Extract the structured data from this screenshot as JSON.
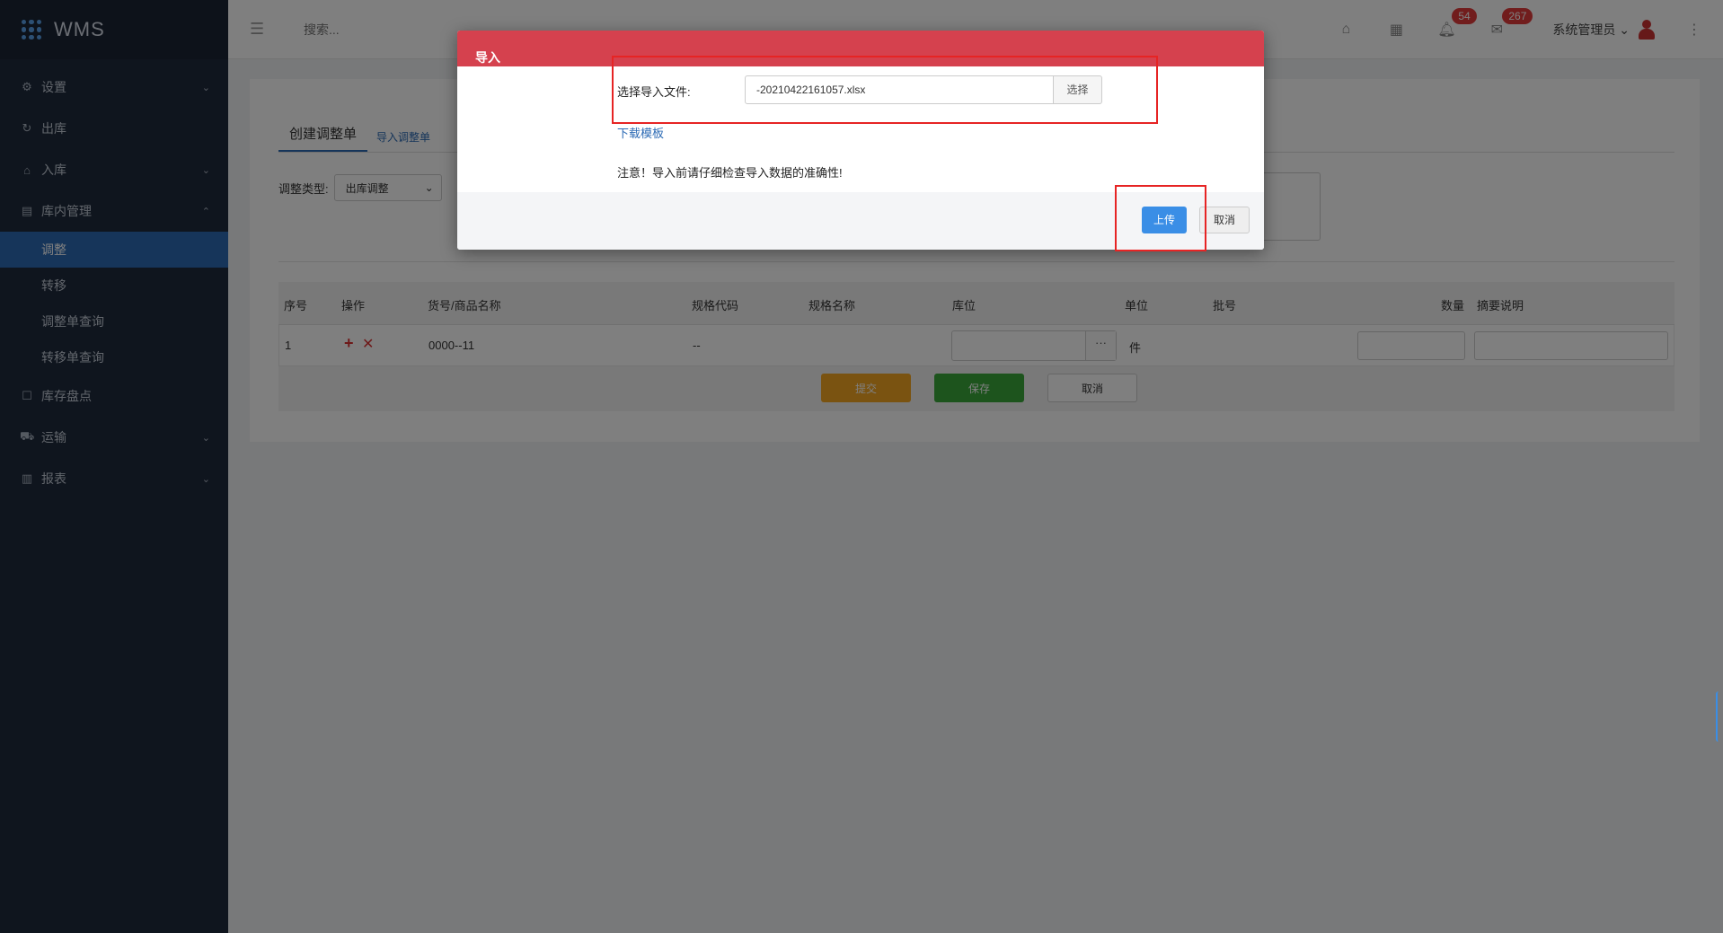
{
  "app": {
    "title": "WMS"
  },
  "sidebar": {
    "items": [
      {
        "label": "设置",
        "icon": "gear-icon",
        "chevron": "chevron-down-icon"
      },
      {
        "label": "出库",
        "icon": "outbound-icon"
      },
      {
        "label": "入库",
        "icon": "inbound-icon",
        "chevron": "chevron-down-icon"
      },
      {
        "label": "库内管理",
        "icon": "warehouse-icon",
        "chevron": "chevron-up-icon"
      },
      {
        "label": "库存盘点",
        "icon": "inventory-icon"
      },
      {
        "label": "运输",
        "icon": "truck-icon",
        "chevron": "chevron-down-icon"
      },
      {
        "label": "报表",
        "icon": "chart-icon",
        "chevron": "chevron-down-icon"
      }
    ],
    "submenu": [
      {
        "label": "调整",
        "active": true
      },
      {
        "label": "转移"
      },
      {
        "label": "调整单查询"
      },
      {
        "label": "转移单查询"
      }
    ]
  },
  "topbar": {
    "search_placeholder": "搜索...",
    "notifications_badge": "54",
    "messages_badge": "267",
    "user_name": "系统管理员"
  },
  "main": {
    "tabs": [
      {
        "label": "创建调整单"
      },
      {
        "label": "导入调整单"
      }
    ],
    "adjust_type_label": "调整类型:",
    "adjust_type_value": "出库调整",
    "table": {
      "headers": [
        "序号",
        "操作",
        "货号/商品名称",
        "规格代码",
        "规格名称",
        "库位",
        "单位",
        "批号",
        "数量",
        "摘要说明"
      ],
      "rows": [
        {
          "index": "1",
          "sku": "0000--11",
          "spec_code": "--",
          "unit": "件"
        }
      ]
    },
    "buttons": {
      "submit": "提交",
      "save": "保存",
      "cancel": "取消"
    }
  },
  "modal": {
    "title": "导入",
    "file_label": "选择导入文件:",
    "file_value": "-20210422161057.xlsx",
    "choose_button": "选择",
    "download_link": "下载模板",
    "notice": "注意！导入前请仔细检查导入数据的准确性!",
    "upload_button": "上传",
    "cancel_button": "取消"
  },
  "colors": {
    "sidebar_bg": "#1f2a3c",
    "accent": "#2d6bb5",
    "modal_header": "#d5414e",
    "upload_button": "#3a8ee6",
    "highlight": "#e62424"
  }
}
